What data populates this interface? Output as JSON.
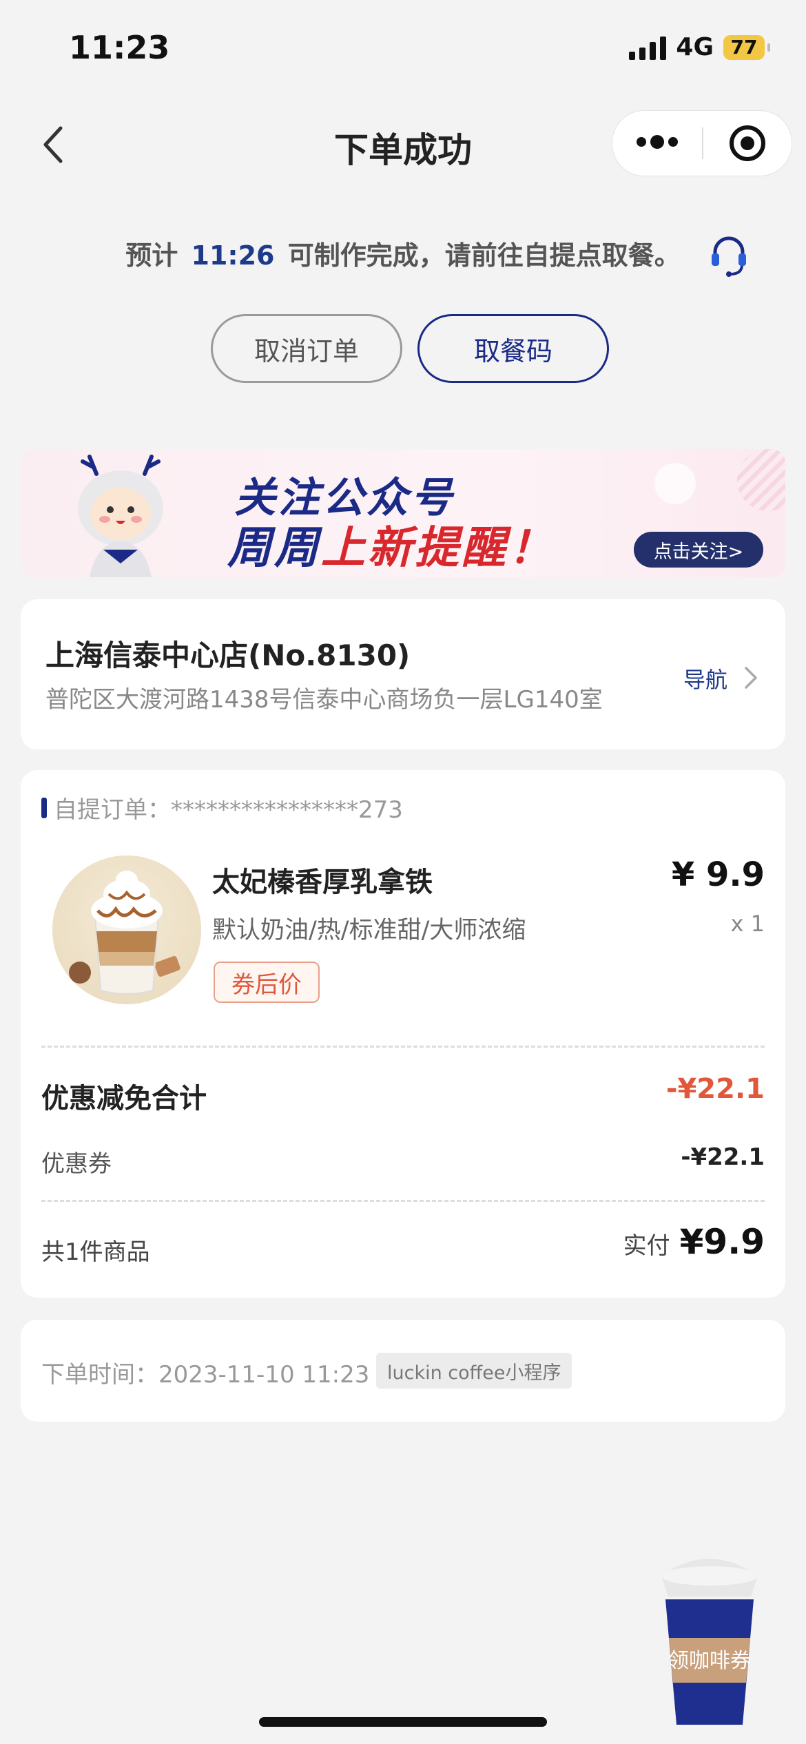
{
  "status_bar": {
    "time": "11:23",
    "network": "4G",
    "battery": "77"
  },
  "nav": {
    "title": "下单成功"
  },
  "estimate": {
    "prefix": "预计",
    "time": "11:26",
    "suffix": "可制作完成，请前往自提点取餐。"
  },
  "actions": {
    "cancel_label": "取消订单",
    "pickup_code_label": "取餐码"
  },
  "banner": {
    "line1": "关注公众号",
    "line2_a": "周周",
    "line2_b": "上新提醒！",
    "follow_label": "点击关注>"
  },
  "store": {
    "name": "上海信泰中心店(No.8130)",
    "address": "普陀区大渡河路1438号信泰中心商场负一层LG140室",
    "nav_label": "导航"
  },
  "order": {
    "label": "自提订单：",
    "number": "****************273",
    "product": {
      "name": "太妃榛香厚乳拿铁",
      "spec": "默认奶油/热/标准甜/大师浓缩",
      "tag": "券后价",
      "price": "¥ 9.9",
      "qty": "x 1"
    },
    "discount_title": "优惠减免合计",
    "discount_total": "-¥22.1",
    "coupon_label": "优惠券",
    "coupon_value": "-¥22.1",
    "count_label": "共1件商品",
    "paid_label": "实付",
    "paid_value": "¥9.9"
  },
  "order_time": {
    "label": "下单时间：2023-11-10 11:23",
    "source": "luckin coffee小程序"
  },
  "floating": {
    "label": "领咖啡券"
  },
  "colors": {
    "brand": "#1b2a86",
    "accent": "#e0573a",
    "background": "#f3f3f3"
  }
}
